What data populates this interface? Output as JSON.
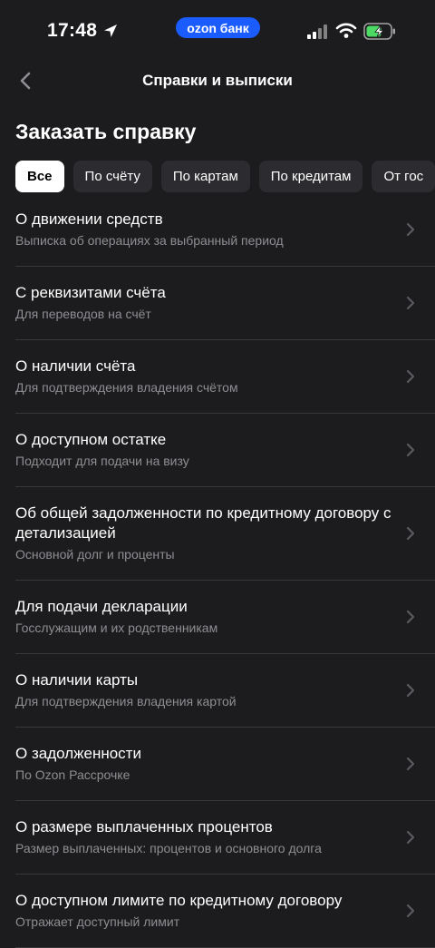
{
  "status_bar": {
    "time": "17:48",
    "brand": "ozon банк"
  },
  "nav": {
    "title": "Справки и выписки"
  },
  "section_title": "Заказать справку",
  "chips": [
    {
      "label": "Все",
      "active": true
    },
    {
      "label": "По счёту",
      "active": false
    },
    {
      "label": "По картам",
      "active": false
    },
    {
      "label": "По кредитам",
      "active": false
    },
    {
      "label": "От гос",
      "active": false
    }
  ],
  "items": [
    {
      "title": "О движении средств",
      "subtitle": "Выписка об операциях за выбранный период"
    },
    {
      "title": "С реквизитами счёта",
      "subtitle": "Для переводов на счёт"
    },
    {
      "title": "О наличии счёта",
      "subtitle": "Для подтверждения владения счётом"
    },
    {
      "title": "О доступном остатке",
      "subtitle": "Подходит для подачи на визу"
    },
    {
      "title": "Об общей задолженности по кредитному договору с детализацией",
      "subtitle": "Основной долг и проценты"
    },
    {
      "title": "Для подачи декларации",
      "subtitle": "Госслужащим и их родственникам"
    },
    {
      "title": "О наличии карты",
      "subtitle": "Для подтверждения владения картой"
    },
    {
      "title": "О задолженности",
      "subtitle": "По Ozon Рассрочке"
    },
    {
      "title": "О размере выплаченных процентов",
      "subtitle": "Размер выплаченных: процентов и основного долга"
    },
    {
      "title": "О доступном лимите по кредитному договору",
      "subtitle": "Отражает доступный лимит"
    }
  ],
  "colors": {
    "background": "#1c1c1e",
    "brand_accent": "#1a5cff",
    "battery_charging": "#4cd964"
  }
}
